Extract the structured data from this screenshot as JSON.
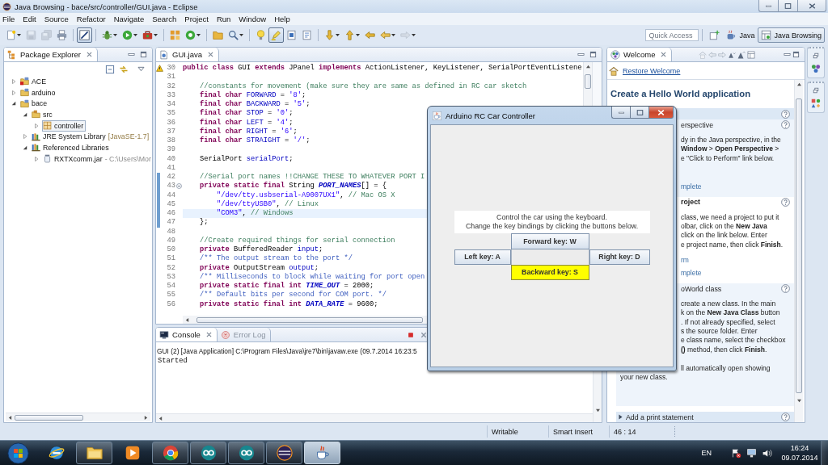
{
  "window": {
    "title": "Java Browsing - bace/src/controller/GUI.java - Eclipse"
  },
  "menu": [
    "File",
    "Edit",
    "Source",
    "Refactor",
    "Navigate",
    "Search",
    "Project",
    "Run",
    "Window",
    "Help"
  ],
  "toolbar": [
    [
      {
        "pressed": false,
        "disabled": false,
        "dropdown": true
      },
      {
        "pressed": false,
        "disabled": true,
        "dropdown": false
      },
      {
        "pressed": false,
        "disabled": true,
        "dropdown": false
      },
      {
        "pressed": false,
        "disabled": false,
        "dropdown": false
      }
    ],
    [
      {
        "pressed": true,
        "disabled": false,
        "dropdown": false
      }
    ],
    [
      {
        "pressed": false,
        "disabled": false,
        "dropdown": true
      },
      {
        "pressed": false,
        "disabled": false,
        "dropdown": true
      },
      {
        "pressed": false,
        "disabled": false,
        "dropdown": true
      }
    ],
    [
      {
        "pressed": false,
        "disabled": false,
        "dropdown": false
      },
      {
        "pressed": false,
        "disabled": false,
        "dropdown": true
      }
    ],
    [
      {
        "pressed": false,
        "disabled": false,
        "dropdown": false
      },
      {
        "pressed": false,
        "disabled": false,
        "dropdown": true
      }
    ],
    [
      {
        "pressed": false,
        "disabled": false,
        "dropdown": false
      },
      {
        "pressed": true,
        "disabled": false,
        "dropdown": false
      },
      {
        "pressed": false,
        "disabled": false,
        "dropdown": false
      },
      {
        "pressed": false,
        "disabled": false,
        "dropdown": false
      }
    ],
    [
      {
        "pressed": false,
        "disabled": false,
        "dropdown": true
      },
      {
        "pressed": false,
        "disabled": false,
        "dropdown": true
      },
      {
        "pressed": false,
        "disabled": false,
        "dropdown": false
      },
      {
        "pressed": false,
        "disabled": false,
        "dropdown": true
      },
      {
        "pressed": false,
        "disabled": true,
        "dropdown": true
      }
    ]
  ],
  "quick_access": {
    "placeholder": "Quick Access"
  },
  "perspectives": [
    {
      "label": "Java",
      "selected": false
    },
    {
      "label": "Java Browsing",
      "selected": true
    }
  ],
  "package_explorer": {
    "title": "Package Explorer",
    "items": [
      {
        "label": "ACE",
        "kind": "project",
        "expanded": false,
        "selected": false,
        "error": true
      },
      {
        "label": "arduino",
        "kind": "project",
        "expanded": false,
        "selected": false,
        "error": false
      },
      {
        "label": "bace",
        "kind": "project",
        "expanded": true,
        "selected": false,
        "error": false,
        "children": [
          {
            "label": "src",
            "kind": "source_folder",
            "expanded": true,
            "selected": false,
            "error": false,
            "children": [
              {
                "label": "controller",
                "kind": "package",
                "expanded": false,
                "selected": true,
                "error": false
              }
            ]
          },
          {
            "label": "JRE System Library",
            "decoration": "[JavaSE-1.7]",
            "kind": "library",
            "expanded": false,
            "selected": false,
            "error": false
          },
          {
            "label": "Referenced Libraries",
            "kind": "library",
            "expanded": true,
            "selected": false,
            "error": false,
            "children": [
              {
                "label": "RXTXcomm.jar",
                "decoration": "- C:\\Users\\Mor",
                "kind": "jar",
                "expanded": false,
                "selected": false,
                "error": false
              }
            ]
          }
        ]
      }
    ]
  },
  "editor": {
    "tab": "GUI.java",
    "lines": [
      {
        "number": "30",
        "tokens": [
          {
            "text": "public class",
            "kind": "keyword"
          },
          {
            "text": " GUI ",
            "kind": "plain"
          },
          {
            "text": "extends",
            "kind": "keyword"
          },
          {
            "text": " JPanel ",
            "kind": "plain"
          },
          {
            "text": "implements",
            "kind": "keyword"
          },
          {
            "text": " ActionListener, KeyListener, SerialPortEventListene",
            "kind": "plain"
          }
        ],
        "current": false,
        "in_range": false,
        "fold": false,
        "warning": true
      },
      {
        "number": "31",
        "current": false,
        "in_range": false,
        "fold": false,
        "warning": false
      },
      {
        "number": "32",
        "tokens": [
          {
            "text": "    //constants for movement (make sure they are same as defined in RC car sketch",
            "kind": "comment"
          }
        ],
        "current": false,
        "in_range": false,
        "fold": false,
        "warning": false
      },
      {
        "number": "33",
        "tokens": [
          {
            "text": "    final char ",
            "kind": "keyword"
          },
          {
            "text": "FORWARD",
            "kind": "field"
          },
          {
            "text": " = ",
            "kind": "plain"
          },
          {
            "text": "'8'",
            "kind": "string"
          },
          {
            "text": ";",
            "kind": "plain"
          }
        ],
        "current": false,
        "in_range": false,
        "fold": false,
        "warning": false
      },
      {
        "number": "34",
        "tokens": [
          {
            "text": "    final char ",
            "kind": "keyword"
          },
          {
            "text": "BACKWARD",
            "kind": "field"
          },
          {
            "text": " = ",
            "kind": "plain"
          },
          {
            "text": "'5'",
            "kind": "string"
          },
          {
            "text": ";",
            "kind": "plain"
          }
        ],
        "current": false,
        "in_range": false,
        "fold": false,
        "warning": false
      },
      {
        "number": "35",
        "tokens": [
          {
            "text": "    final char ",
            "kind": "keyword"
          },
          {
            "text": "STOP",
            "kind": "field"
          },
          {
            "text": " = ",
            "kind": "plain"
          },
          {
            "text": "'0'",
            "kind": "string"
          },
          {
            "text": ";",
            "kind": "plain"
          }
        ],
        "current": false,
        "in_range": false,
        "fold": false,
        "warning": false
      },
      {
        "number": "36",
        "tokens": [
          {
            "text": "    final char ",
            "kind": "keyword"
          },
          {
            "text": "LEFT",
            "kind": "field"
          },
          {
            "text": " = ",
            "kind": "plain"
          },
          {
            "text": "'4'",
            "kind": "string"
          },
          {
            "text": ";",
            "kind": "plain"
          }
        ],
        "current": false,
        "in_range": false,
        "fold": false,
        "warning": false
      },
      {
        "number": "37",
        "tokens": [
          {
            "text": "    final char ",
            "kind": "keyword"
          },
          {
            "text": "RIGHT",
            "kind": "field"
          },
          {
            "text": " = ",
            "kind": "plain"
          },
          {
            "text": "'6'",
            "kind": "string"
          },
          {
            "text": ";",
            "kind": "plain"
          }
        ],
        "current": false,
        "in_range": false,
        "fold": false,
        "warning": false
      },
      {
        "number": "38",
        "tokens": [
          {
            "text": "    final char ",
            "kind": "keyword"
          },
          {
            "text": "STRAIGHT",
            "kind": "field"
          },
          {
            "text": " = ",
            "kind": "plain"
          },
          {
            "text": "'/'",
            "kind": "string"
          },
          {
            "text": ";",
            "kind": "plain"
          }
        ],
        "current": false,
        "in_range": false,
        "fold": false,
        "warning": false
      },
      {
        "number": "39",
        "current": false,
        "in_range": false,
        "fold": false,
        "warning": false
      },
      {
        "number": "40",
        "tokens": [
          {
            "text": "    SerialPort ",
            "kind": "plain"
          },
          {
            "text": "serialPort",
            "kind": "field"
          },
          {
            "text": ";",
            "kind": "plain"
          }
        ],
        "current": false,
        "in_range": false,
        "fold": false,
        "warning": false
      },
      {
        "number": "41",
        "current": false,
        "in_range": false,
        "fold": false,
        "warning": false
      },
      {
        "number": "42",
        "tokens": [
          {
            "text": "    //Serial port names !!CHANGE THESE TO WHATEVER PORT I",
            "kind": "comment"
          }
        ],
        "current": false,
        "in_range": true,
        "fold": false,
        "warning": false
      },
      {
        "number": "43",
        "tokens": [
          {
            "text": "    private static final",
            "kind": "keyword"
          },
          {
            "text": " String ",
            "kind": "plain"
          },
          {
            "text": "PORT_NAMES",
            "kind": "constant"
          },
          {
            "text": "[] = {",
            "kind": "plain"
          }
        ],
        "current": false,
        "in_range": true,
        "fold": true,
        "warning": false
      },
      {
        "number": "44",
        "tokens": [
          {
            "text": "        \"/dev/tty.usbserial-A9007UX1\"",
            "kind": "string"
          },
          {
            "text": ", ",
            "kind": "plain"
          },
          {
            "text": "// Mac OS X",
            "kind": "comment"
          }
        ],
        "current": false,
        "in_range": true,
        "fold": false,
        "warning": false
      },
      {
        "number": "45",
        "tokens": [
          {
            "text": "        \"/dev/ttyUSB0\"",
            "kind": "string"
          },
          {
            "text": ", ",
            "kind": "plain"
          },
          {
            "text": "// Linux",
            "kind": "comment"
          }
        ],
        "current": false,
        "in_range": true,
        "fold": false,
        "warning": false
      },
      {
        "number": "46",
        "tokens": [
          {
            "text": "        \"COM3\"",
            "kind": "string"
          },
          {
            "text": ", ",
            "kind": "plain"
          },
          {
            "text": "// Windows",
            "kind": "comment"
          }
        ],
        "current": true,
        "in_range": true,
        "fold": false,
        "warning": false
      },
      {
        "number": "47",
        "tokens": [
          {
            "text": "    };",
            "kind": "plain"
          }
        ],
        "current": false,
        "in_range": true,
        "fold": false,
        "warning": false
      },
      {
        "number": "48",
        "current": false,
        "in_range": false,
        "fold": false,
        "warning": false
      },
      {
        "number": "49",
        "tokens": [
          {
            "text": "    //Create required things for serial connection",
            "kind": "comment"
          }
        ],
        "current": false,
        "in_range": false,
        "fold": false,
        "warning": false
      },
      {
        "number": "50",
        "tokens": [
          {
            "text": "    private",
            "kind": "keyword"
          },
          {
            "text": " BufferedReader ",
            "kind": "plain"
          },
          {
            "text": "input",
            "kind": "field"
          },
          {
            "text": ";",
            "kind": "plain"
          }
        ],
        "current": false,
        "in_range": false,
        "fold": false,
        "warning": false
      },
      {
        "number": "51",
        "tokens": [
          {
            "text": "    /** The output stream to the port */",
            "kind": "javadoc"
          }
        ],
        "current": false,
        "in_range": false,
        "fold": false,
        "warning": false
      },
      {
        "number": "52",
        "tokens": [
          {
            "text": "    private",
            "kind": "keyword"
          },
          {
            "text": " OutputStream ",
            "kind": "plain"
          },
          {
            "text": "output",
            "kind": "field"
          },
          {
            "text": ";",
            "kind": "plain"
          }
        ],
        "current": false,
        "in_range": false,
        "fold": false,
        "warning": false
      },
      {
        "number": "53",
        "tokens": [
          {
            "text": "    /** Milliseconds to block while waiting for port open",
            "kind": "javadoc"
          }
        ],
        "current": false,
        "in_range": false,
        "fold": false,
        "warning": false
      },
      {
        "number": "54",
        "tokens": [
          {
            "text": "    private static final int ",
            "kind": "keyword"
          },
          {
            "text": "TIME_OUT",
            "kind": "constant"
          },
          {
            "text": " = 2000;",
            "kind": "plain"
          }
        ],
        "current": false,
        "in_range": false,
        "fold": false,
        "warning": false
      },
      {
        "number": "55",
        "tokens": [
          {
            "text": "    /** Default bits per second for COM port. */",
            "kind": "javadoc"
          }
        ],
        "current": false,
        "in_range": false,
        "fold": false,
        "warning": false
      },
      {
        "number": "56",
        "tokens": [
          {
            "text": "    private static final int ",
            "kind": "keyword"
          },
          {
            "text": "DATA_RATE",
            "kind": "constant"
          },
          {
            "text": " = 9600;",
            "kind": "plain"
          }
        ],
        "current": false,
        "in_range": false,
        "fold": false,
        "warning": false
      }
    ]
  },
  "console": {
    "tabs": [
      {
        "label": "Console",
        "selected": true
      },
      {
        "label": "Error Log",
        "selected": false
      }
    ],
    "header": "GUI (2) [Java Application] C:\\Program Files\\Java\\jre7\\bin\\javaw.exe (09.7.2014 16:23:5",
    "output": "Started"
  },
  "welcome": {
    "tab": "Welcome",
    "link": "Restore Welcome",
    "heading": "Create a Hello World application",
    "sections": [
      {
        "kind": "intro"
      },
      {
        "kind": "step",
        "collapsed": false,
        "current": false,
        "title": {
          "text": "erspective",
          "clipped": true
        },
        "paragraphs": [
          [
            {
              "text": "dy in the Java perspective, in the",
              "clipped": true
            },
            {
              "text": "**Window** > **Open Perspective** >",
              "clipped": true
            },
            {
              "text": "e \"Click to Perform\" link below.",
              "clipped": true
            }
          ]
        ],
        "links": [
          {
            "text": "mplete",
            "clipped": true
          }
        ]
      },
      {
        "kind": "step",
        "collapsed": false,
        "current": true,
        "title": {
          "text": "roject",
          "clipped": true
        },
        "paragraphs": [
          [
            {
              "text": "class, we need a project to put it",
              "clipped": true
            },
            {
              "text": "olbar, click on the **New Java**",
              "clipped": true
            },
            {
              "text": "click on the link below. Enter",
              "clipped": true
            },
            {
              "text": "e project name, then click **Finish**.",
              "clipped": true
            }
          ]
        ],
        "links": [
          {
            "text": "rm",
            "clipped": true
          },
          {
            "text": "mplete",
            "clipped": true
          }
        ]
      },
      {
        "kind": "step",
        "collapsed": false,
        "current": false,
        "title": {
          "text": "oWorld class",
          "clipped": true
        },
        "paragraphs": [
          [
            {
              "text": "create a new class. In the main",
              "clipped": true
            },
            {
              "text": "k on the **New Java Class** button",
              "clipped": true
            },
            {
              "text": ". If not already specified, select",
              "clipped": true
            },
            {
              "text": "s the source folder. Enter",
              "clipped": true
            },
            {
              "text": "e class name, select the checkbox",
              "clipped": true
            },
            {
              "text": "**()** method, then click **Finish**.",
              "clipped": true
            }
          ],
          [
            {
              "text": "ll automatically open showing",
              "clipped": true
            },
            {
              "text": "your new class."
            }
          ]
        ]
      },
      {
        "kind": "step",
        "collapsed": true,
        "current": false,
        "title": {
          "text": "Add a print statement"
        }
      }
    ]
  },
  "status_bar": [
    "Writable",
    "Smart Insert",
    "46 : 14"
  ],
  "taskbar": {
    "apps": [
      {
        "running": false,
        "active": false
      },
      {
        "running": true,
        "active": false
      },
      {
        "running": false,
        "active": false
      },
      {
        "running": true,
        "active": false
      },
      {
        "running": true,
        "active": false
      },
      {
        "running": true,
        "active": false
      },
      {
        "running": true,
        "active": false
      },
      {
        "running": true,
        "active": true
      }
    ],
    "language": "EN",
    "time": "16:24",
    "date": "09.07.2014"
  },
  "dialog": {
    "title": "Arduino RC Car Controller",
    "message": [
      "Control the car using the keyboard.",
      "Change the key bindings by clicking the buttons below."
    ],
    "keys": [
      {
        "label": "Forward key: W",
        "highlighted": false
      },
      {
        "label": "Left key: A",
        "highlighted": false
      },
      {
        "label": "Right key: D",
        "highlighted": false
      },
      {
        "label": "Backward key: S",
        "highlighted": true
      }
    ]
  }
}
